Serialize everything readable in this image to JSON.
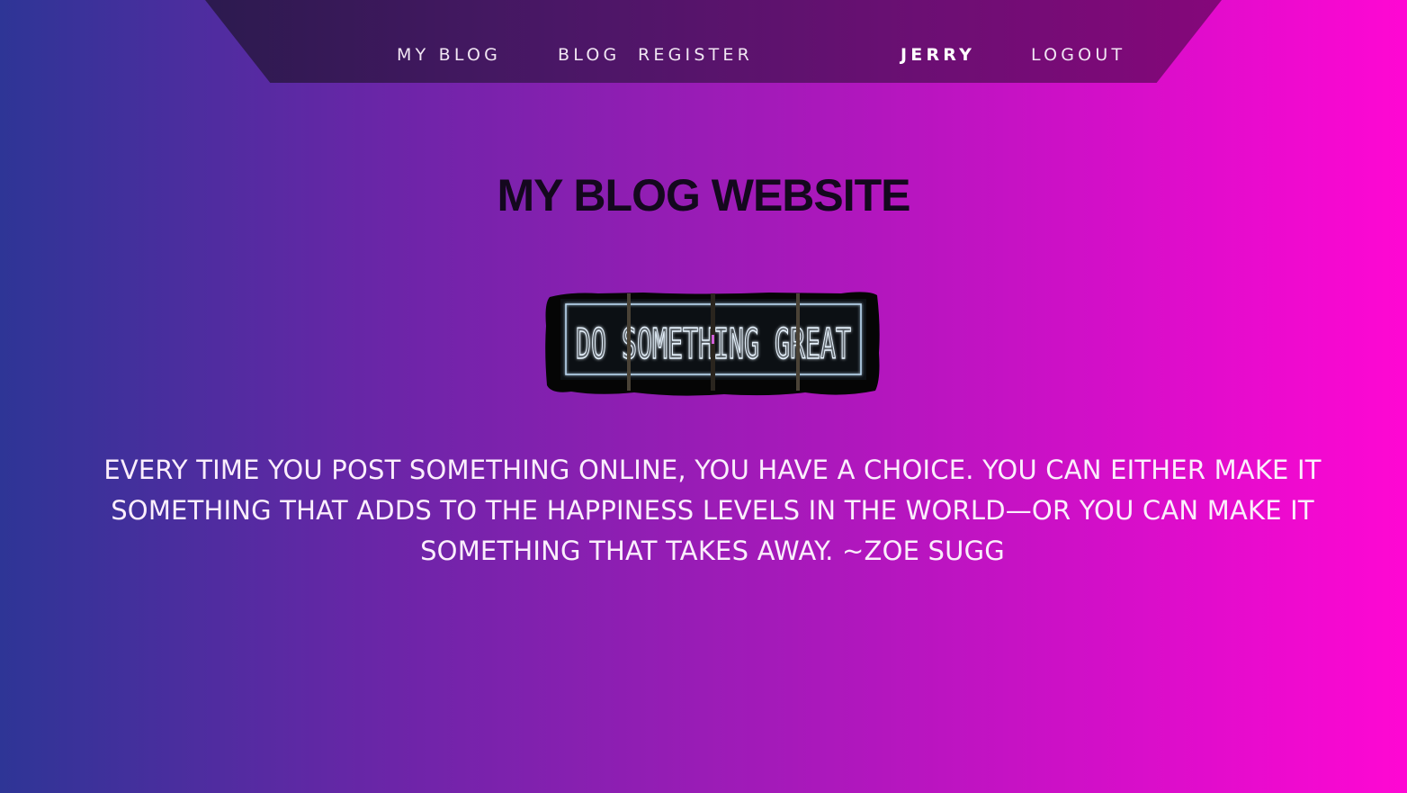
{
  "nav": {
    "my_blog": "MY BLOG",
    "blog": "BLOG",
    "register": "REGISTER",
    "username": "JERRY",
    "logout": "LOGOUT"
  },
  "main": {
    "title": "MY BLOG WEBSITE",
    "hero_image": {
      "sign_text": "DO SOMETHING GREAT"
    },
    "quote": "EVERY TIME YOU POST SOMETHING ONLINE, YOU HAVE A CHOICE. YOU CAN EITHER MAKE IT SOMETHING THAT ADDS TO THE HAPPINESS LEVELS IN THE WORLD—OR YOU CAN MAKE IT SOMETHING THAT TAKES AWAY. ~ZOE SUGG"
  },
  "colors": {
    "gradient_left": "#2e3596",
    "gradient_right": "#ff07d3",
    "navbar": "#4a1766",
    "title": "#14081e",
    "quote_text": "#fbeefc"
  }
}
